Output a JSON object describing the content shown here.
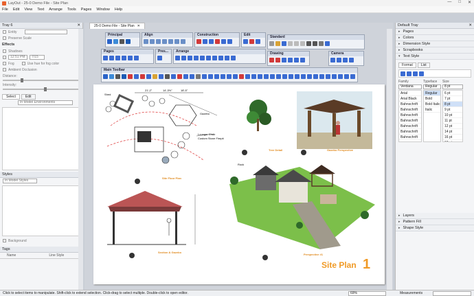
{
  "window": {
    "title": "LayOut - 25-0 Demo File - Site Plan",
    "controls": [
      "—",
      "□",
      "✕"
    ]
  },
  "menu": [
    "File",
    "Edit",
    "View",
    "Text",
    "Arrange",
    "Tools",
    "Pages",
    "Window",
    "Help"
  ],
  "left_tray": {
    "title": "Tray 6",
    "grid_label": "Entity",
    "preserve_scale": "Preserve Scale",
    "effects": "Effects",
    "shadows": "Shadows",
    "time": "12:51 PM",
    "date": "7/15",
    "fog": "Fog",
    "use_bg": "Use hue for fog color",
    "ambient": "Ambient Occlusion",
    "distance": "Distance:",
    "intensity": "Intensity:",
    "select_tab": "Select",
    "edit_tab": "Edit",
    "in_model": "In Model Environments",
    "styles": "Styles",
    "in_model_styles": "In Model Styles",
    "background": "Background",
    "tags": "Tags",
    "tags_cols": [
      "Name",
      "Line Style"
    ]
  },
  "doc_tab": {
    "label": "25-0 Demo File - Site Plan"
  },
  "toolbars": {
    "principal": "Principal",
    "align": "Align",
    "construction": "Construction",
    "edit": "Edit",
    "standard": "Standard",
    "pages": "Pages",
    "pres": "Pres...",
    "arrange": "Arrange",
    "drawing": "Drawing",
    "camera": "Camera",
    "main": "Main Toolbar"
  },
  "sheet": {
    "labels": {
      "site_floor": "Site Floor Plan",
      "tree": "Tree Detail",
      "gazebo": "Gazebo Perspective",
      "section": "Section & Gazebo",
      "perspective": "Perspective #1",
      "shed": "Shed",
      "gazebo_note": "Gazebo",
      "lounge": "Lounger Chair",
      "custom": "Custom Stone Firepit",
      "rock": "Rock"
    },
    "dims": [
      "21'-2\"",
      "14'-3½\"",
      "18'-5\""
    ],
    "title": "Site Plan",
    "number": "1"
  },
  "right_tray": {
    "title": "Default Tray",
    "sections": [
      "Pages",
      "Colors",
      "Dimension Style",
      "Scrapbooks",
      "Text Style"
    ],
    "tabs": [
      "Format",
      "List"
    ],
    "family_hdr": "Family",
    "typeface_hdr": "Typeface",
    "size_hdr": "Size",
    "family_value": "Verdana",
    "typeface_value": "Regular",
    "size_value": "8 pt",
    "families": [
      "Arial",
      "Arial Black",
      "Bahnschrift",
      "Bahnschrift",
      "Bahnschrift",
      "Bahnschrift",
      "Bahnschrift",
      "Bahnschrift",
      "Bahnschrift"
    ],
    "typefaces": [
      "Regular",
      "Bold",
      "Bold Italic",
      "Italic"
    ],
    "sizes": [
      "6 pt",
      "7 pt",
      "8 pt",
      "9 pt",
      "10 pt",
      "11 pt",
      "12 pt",
      "14 pt",
      "16 pt",
      "18 pt",
      "20 pt"
    ],
    "bottom_sections": [
      "Layers",
      "Pattern Fill",
      "Shape Style"
    ]
  },
  "status": {
    "hint": "Click to select items to manipulate. Shift-click to extend selection. Click-drag to select multiple. Double-click to open editor.",
    "zoom": "69%",
    "measurements": "Measurements"
  }
}
